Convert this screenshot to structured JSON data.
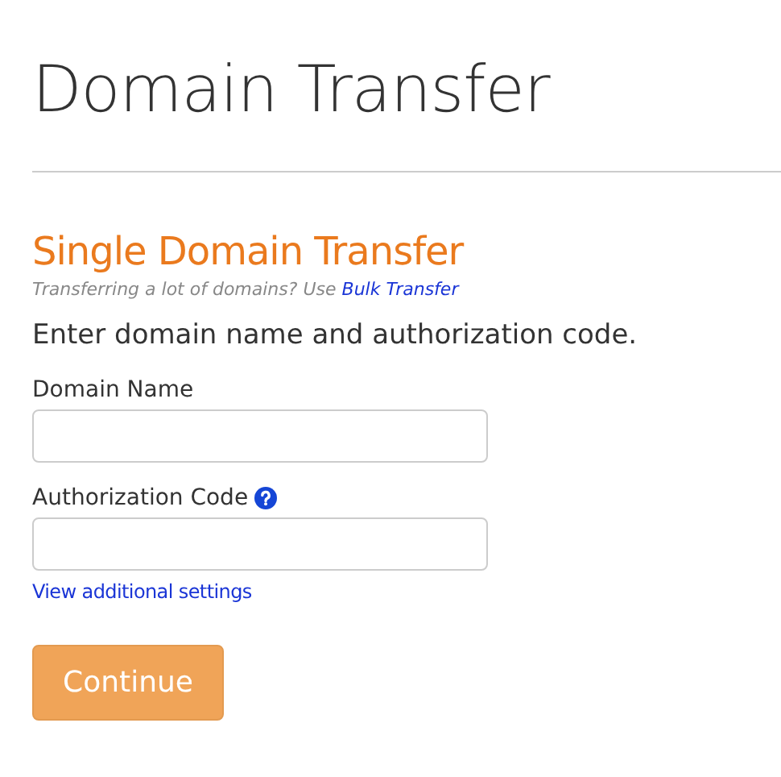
{
  "page_title": "Domain Transfer",
  "section_title": "Single Domain Transfer",
  "note": {
    "text": "Transferring a lot of domains? Use",
    "link": "Bulk Transfer"
  },
  "instruction": "Enter domain name and authorization code.",
  "fields": [
    {
      "label": "Domain Name",
      "help": false
    },
    {
      "label": "Authorization Code",
      "help": true
    }
  ],
  "settings_link": "View additional settings",
  "submit_button": "Continue"
}
